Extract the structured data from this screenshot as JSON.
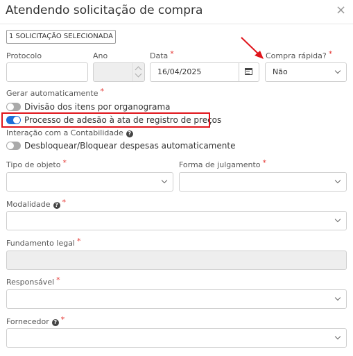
{
  "dialog": {
    "title": "Atendendo solicitação de compra",
    "close_icon": "×",
    "badge": "1 SOLICITAÇÃO SELECIONADA"
  },
  "fields": {
    "protocolo": {
      "label": "Protocolo",
      "value": ""
    },
    "ano": {
      "label": "Ano",
      "value": ""
    },
    "data": {
      "label": "Data",
      "required": "*",
      "value": "16/04/2025"
    },
    "compra_rapida": {
      "label": "Compra rápida?",
      "required": "*",
      "value": "Não"
    },
    "gerar_automaticamente": {
      "label": "Gerar automaticamente",
      "required": "*"
    },
    "interacao": {
      "label": "Interação com a Contabilidade",
      "help": "?"
    },
    "tipo_objeto": {
      "label": "Tipo de objeto",
      "required": "*",
      "value": ""
    },
    "forma_julgamento": {
      "label": "Forma de julgamento",
      "required": "*",
      "value": ""
    },
    "modalidade": {
      "label": "Modalidade",
      "help": "?",
      "required": "*",
      "value": ""
    },
    "fundamento_legal": {
      "label": "Fundamento legal",
      "required": "*",
      "value": ""
    },
    "responsavel": {
      "label": "Responsável",
      "required": "*",
      "value": ""
    },
    "fornecedor": {
      "label": "Fornecedor",
      "help": "?",
      "required": "*",
      "value": ""
    }
  },
  "toggles": {
    "divisao": {
      "label": "Divisão dos itens por organograma",
      "on": false
    },
    "adesao": {
      "label": "Processo de adesão à ata de registro de preços",
      "on": true
    },
    "desbloquear": {
      "label": "Desbloquear/Bloquear despesas automaticamente",
      "on": false
    }
  },
  "colors": {
    "accent": "#1e6fd9",
    "required": "#e53935",
    "annotation": "#e0141b"
  }
}
